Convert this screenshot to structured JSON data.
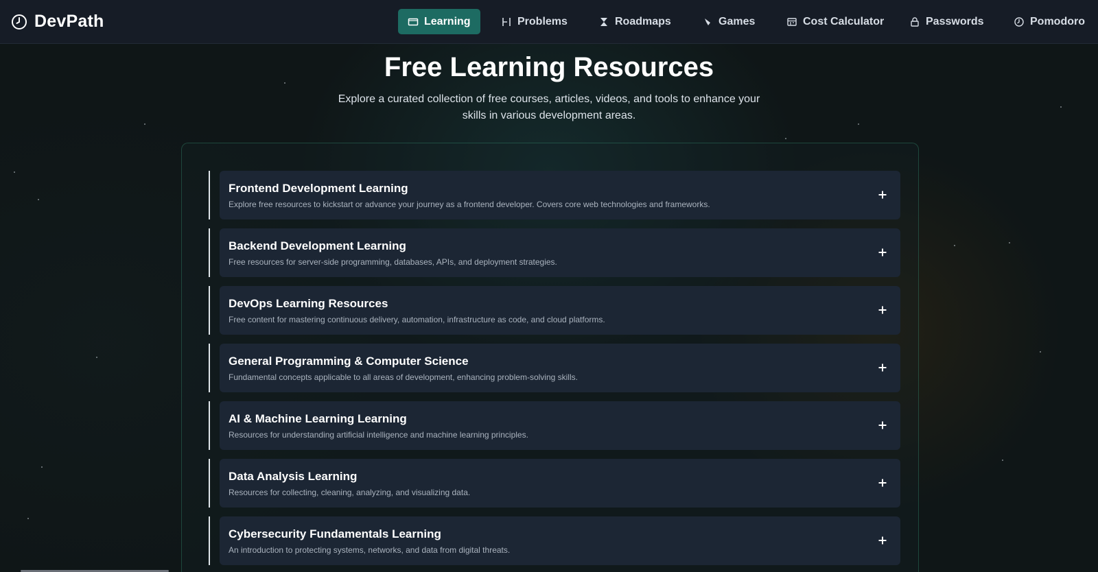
{
  "brand": {
    "name": "DevPath",
    "icon": "clock-icon"
  },
  "nav": {
    "items": [
      {
        "label": "Learning",
        "icon": "book-icon",
        "active": true
      },
      {
        "label": "Problems",
        "icon": "bracket-icon",
        "active": false
      },
      {
        "label": "Roadmaps",
        "icon": "hourglass-icon",
        "active": false
      },
      {
        "label": "Games",
        "icon": "gamepad-icon",
        "active": false
      },
      {
        "label": "Cost Calculator",
        "icon": "calculator-icon",
        "active": false
      },
      {
        "label": "Passwords",
        "icon": "lock-icon",
        "active": false
      },
      {
        "label": "Pomodoro",
        "icon": "clock-icon",
        "active": false
      }
    ]
  },
  "header": {
    "title": "Free Learning Resources",
    "subtitle": "Explore a curated collection of free courses, articles, videos, and tools to enhance your skills in various development areas."
  },
  "sections": [
    {
      "title": "Frontend Development Learning",
      "description": "Explore free resources to kickstart or advance your journey as a frontend developer. Covers core web technologies and frameworks.",
      "icon": "plus-icon"
    },
    {
      "title": "Backend Development Learning",
      "description": "Free resources for server-side programming, databases, APIs, and deployment strategies.",
      "icon": "plus-icon"
    },
    {
      "title": "DevOps Learning Resources",
      "description": "Free content for mastering continuous delivery, automation, infrastructure as code, and cloud platforms.",
      "icon": "plus-icon"
    },
    {
      "title": "General Programming & Computer Science",
      "description": "Fundamental concepts applicable to all areas of development, enhancing problem-solving skills.",
      "icon": "plus-icon"
    },
    {
      "title": "AI & Machine Learning Learning",
      "description": "Resources for understanding artificial intelligence and machine learning principles.",
      "icon": "plus-icon"
    },
    {
      "title": "Data Analysis Learning",
      "description": "Resources for collecting, cleaning, analyzing, and visualizing data.",
      "icon": "plus-icon"
    },
    {
      "title": "Cybersecurity Fundamentals Learning",
      "description": "An introduction to protecting systems, networks, and data from digital threats.",
      "icon": "plus-icon"
    }
  ],
  "colors": {
    "accent": "#1d6b62",
    "navbar": "#161c26",
    "card": "#1c2634",
    "background": "#0f1617"
  }
}
